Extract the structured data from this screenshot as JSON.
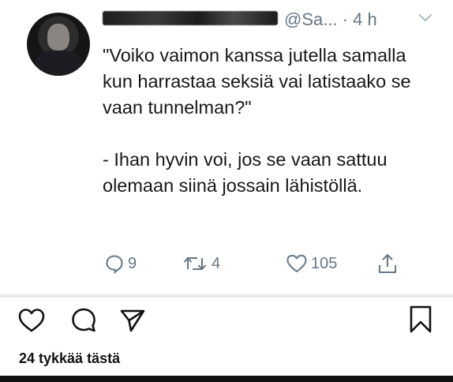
{
  "tweet": {
    "handle_time": "@Sa... · 4 h",
    "text": "\"Voiko vaimon kanssa jutella samalla kun harrastaa seksiä vai latistaako se vaan tunnelman?\"\n\n- Ihan hyvin voi, jos se vaan sattuu olemaan siinä jossain lähistöllä.",
    "actions": {
      "replies": "9",
      "retweets": "4",
      "likes": "105"
    }
  },
  "instagram": {
    "likes_text": "24 tykkää tästä"
  },
  "colors": {
    "text": "#14171a",
    "muted": "#657786",
    "icon_dark": "#111111"
  }
}
